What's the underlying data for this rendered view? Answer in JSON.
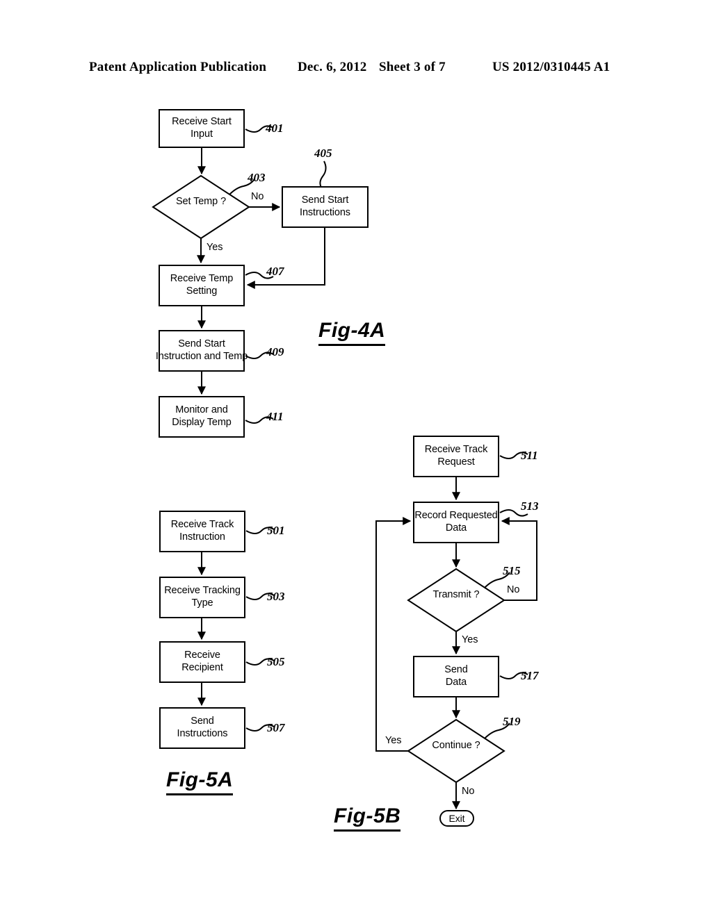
{
  "header": {
    "publication": "Patent Application Publication",
    "date": "Dec. 6, 2012",
    "sheet": "Sheet 3 of 7",
    "patent_number": "US 2012/0310445 A1"
  },
  "figures": [
    {
      "caption": "Fig-4A",
      "nodes": [
        {
          "ref": "401",
          "lines": [
            "Receive Start",
            "Input"
          ],
          "shape": "process"
        },
        {
          "ref": "403",
          "lines": [
            "Set Temp",
            "?"
          ],
          "shape": "decision"
        },
        {
          "ref": "405",
          "lines": [
            "Send Start",
            "Instructions"
          ],
          "shape": "process"
        },
        {
          "ref": "407",
          "lines": [
            "Receive Temp",
            "Setting"
          ],
          "shape": "process"
        },
        {
          "ref": "409",
          "lines": [
            "Send Start",
            "Instruction and Temp"
          ],
          "shape": "process"
        },
        {
          "ref": "411",
          "lines": [
            "Monitor and",
            "Display Temp"
          ],
          "shape": "process"
        }
      ],
      "edge_labels": [
        "No",
        "Yes"
      ]
    },
    {
      "caption": "Fig-5A",
      "nodes": [
        {
          "ref": "501",
          "lines": [
            "Receive Track",
            "Instruction"
          ],
          "shape": "process"
        },
        {
          "ref": "503",
          "lines": [
            "Receive Tracking",
            "Type"
          ],
          "shape": "process"
        },
        {
          "ref": "505",
          "lines": [
            "Receive",
            "Recipient"
          ],
          "shape": "process"
        },
        {
          "ref": "507",
          "lines": [
            "Send",
            "Instructions"
          ],
          "shape": "process"
        }
      ],
      "edge_labels": []
    },
    {
      "caption": "Fig-5B",
      "nodes": [
        {
          "ref": "511",
          "lines": [
            "Receive Track",
            "Request"
          ],
          "shape": "process"
        },
        {
          "ref": "513",
          "lines": [
            "Record Requested",
            "Data"
          ],
          "shape": "process"
        },
        {
          "ref": "515",
          "lines": [
            "Transmit",
            "?"
          ],
          "shape": "decision"
        },
        {
          "ref": "517",
          "lines": [
            "Send",
            "Data"
          ],
          "shape": "process"
        },
        {
          "ref": "519",
          "lines": [
            "Continue",
            "?"
          ],
          "shape": "decision"
        },
        {
          "ref": "exit",
          "lines": [
            "Exit"
          ],
          "shape": "terminator"
        }
      ],
      "edge_labels": [
        "No",
        "Yes",
        "Yes",
        "No"
      ]
    }
  ],
  "fig4a": {
    "node401_line1": "Receive Start",
    "node401_line2": "Input",
    "ref401": "401",
    "node403_line1": "Set Temp",
    "node403_line2": "?",
    "ref403": "403",
    "node405_line1": "Send Start",
    "node405_line2": "Instructions",
    "ref405": "405",
    "node407_line1": "Receive Temp",
    "node407_line2": "Setting",
    "ref407": "407",
    "node409_line1": "Send Start",
    "node409_line2": "Instruction and Temp",
    "ref409": "409",
    "node411_line1": "Monitor and",
    "node411_line2": "Display Temp",
    "ref411": "411",
    "label_no": "No",
    "label_yes": "Yes",
    "caption": "Fig-4A"
  },
  "fig5a": {
    "node501_line1": "Receive Track",
    "node501_line2": "Instruction",
    "ref501": "501",
    "node503_line1": "Receive Tracking",
    "node503_line2": "Type",
    "ref503": "503",
    "node505_line1": "Receive",
    "node505_line2": "Recipient",
    "ref505": "505",
    "node507_line1": "Send",
    "node507_line2": "Instructions",
    "ref507": "507",
    "caption": "Fig-5A"
  },
  "fig5b": {
    "node511_line1": "Receive Track",
    "node511_line2": "Request",
    "ref511": "511",
    "node513_line1": "Record Requested",
    "node513_line2": "Data",
    "ref513": "513",
    "node515_line1": "Transmit",
    "node515_line2": "?",
    "ref515": "515",
    "node517_line1": "Send",
    "node517_line2": "Data",
    "ref517": "517",
    "node519_line1": "Continue",
    "node519_line2": "?",
    "ref519": "519",
    "exit_label": "Exit",
    "label_no_transmit": "No",
    "label_yes_transmit": "Yes",
    "label_yes_continue": "Yes",
    "label_no_continue": "No",
    "caption": "Fig-5B"
  }
}
